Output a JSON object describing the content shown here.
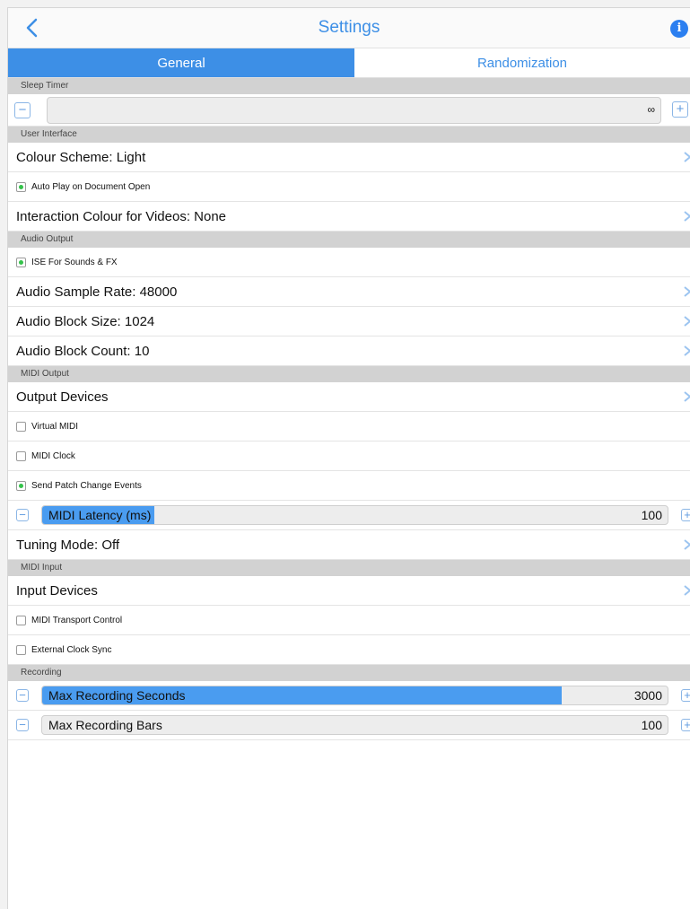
{
  "nav": {
    "title": "Settings",
    "back_icon": "chevron-left-icon",
    "info_icon": "info-icon",
    "info_glyph": "i"
  },
  "tabs": [
    {
      "label": "General",
      "active": true
    },
    {
      "label": "Randomization",
      "active": false
    }
  ],
  "sleep_timer": {
    "header": "Sleep Timer",
    "value": "∞"
  },
  "user_interface": {
    "header": "User Interface",
    "colour_scheme": "Colour Scheme: Light",
    "auto_play": {
      "label": "Auto Play on Document Open",
      "checked": true
    },
    "interaction_colour": "Interaction Colour for Videos: None"
  },
  "audio_output": {
    "header": "Audio Output",
    "ise": {
      "label": "ISE For Sounds & FX",
      "checked": true
    },
    "sample_rate": "Audio Sample Rate: 48000",
    "block_size": "Audio Block Size: 1024",
    "block_count": "Audio Block Count: 10"
  },
  "midi_output": {
    "header": "MIDI Output",
    "output_devices": "Output Devices",
    "virtual_midi": {
      "label": "Virtual MIDI",
      "checked": false
    },
    "midi_clock": {
      "label": "MIDI Clock",
      "checked": false
    },
    "patch_change": {
      "label": "Send Patch Change Events",
      "checked": true
    },
    "latency": {
      "label": "MIDI Latency (ms)",
      "value": "100",
      "level_pct": 18
    },
    "tuning_mode": "Tuning Mode: Off"
  },
  "midi_input": {
    "header": "MIDI Input",
    "input_devices": "Input Devices",
    "transport": {
      "label": "MIDI Transport Control",
      "checked": false
    },
    "ext_clock": {
      "label": "External Clock Sync",
      "checked": false
    }
  },
  "recording": {
    "header": "Recording",
    "max_seconds": {
      "label": "Max Recording Seconds",
      "value": "3000",
      "level_pct": 83
    },
    "max_bars": {
      "label": "Max Recording Bars",
      "value": "100",
      "level_pct": 0
    }
  },
  "stepper": {
    "minus": "−",
    "plus": "+"
  },
  "colors": {
    "accent": "#3d8fe6",
    "check_on": "#34c24a",
    "section_bg": "#d2d2d2"
  }
}
